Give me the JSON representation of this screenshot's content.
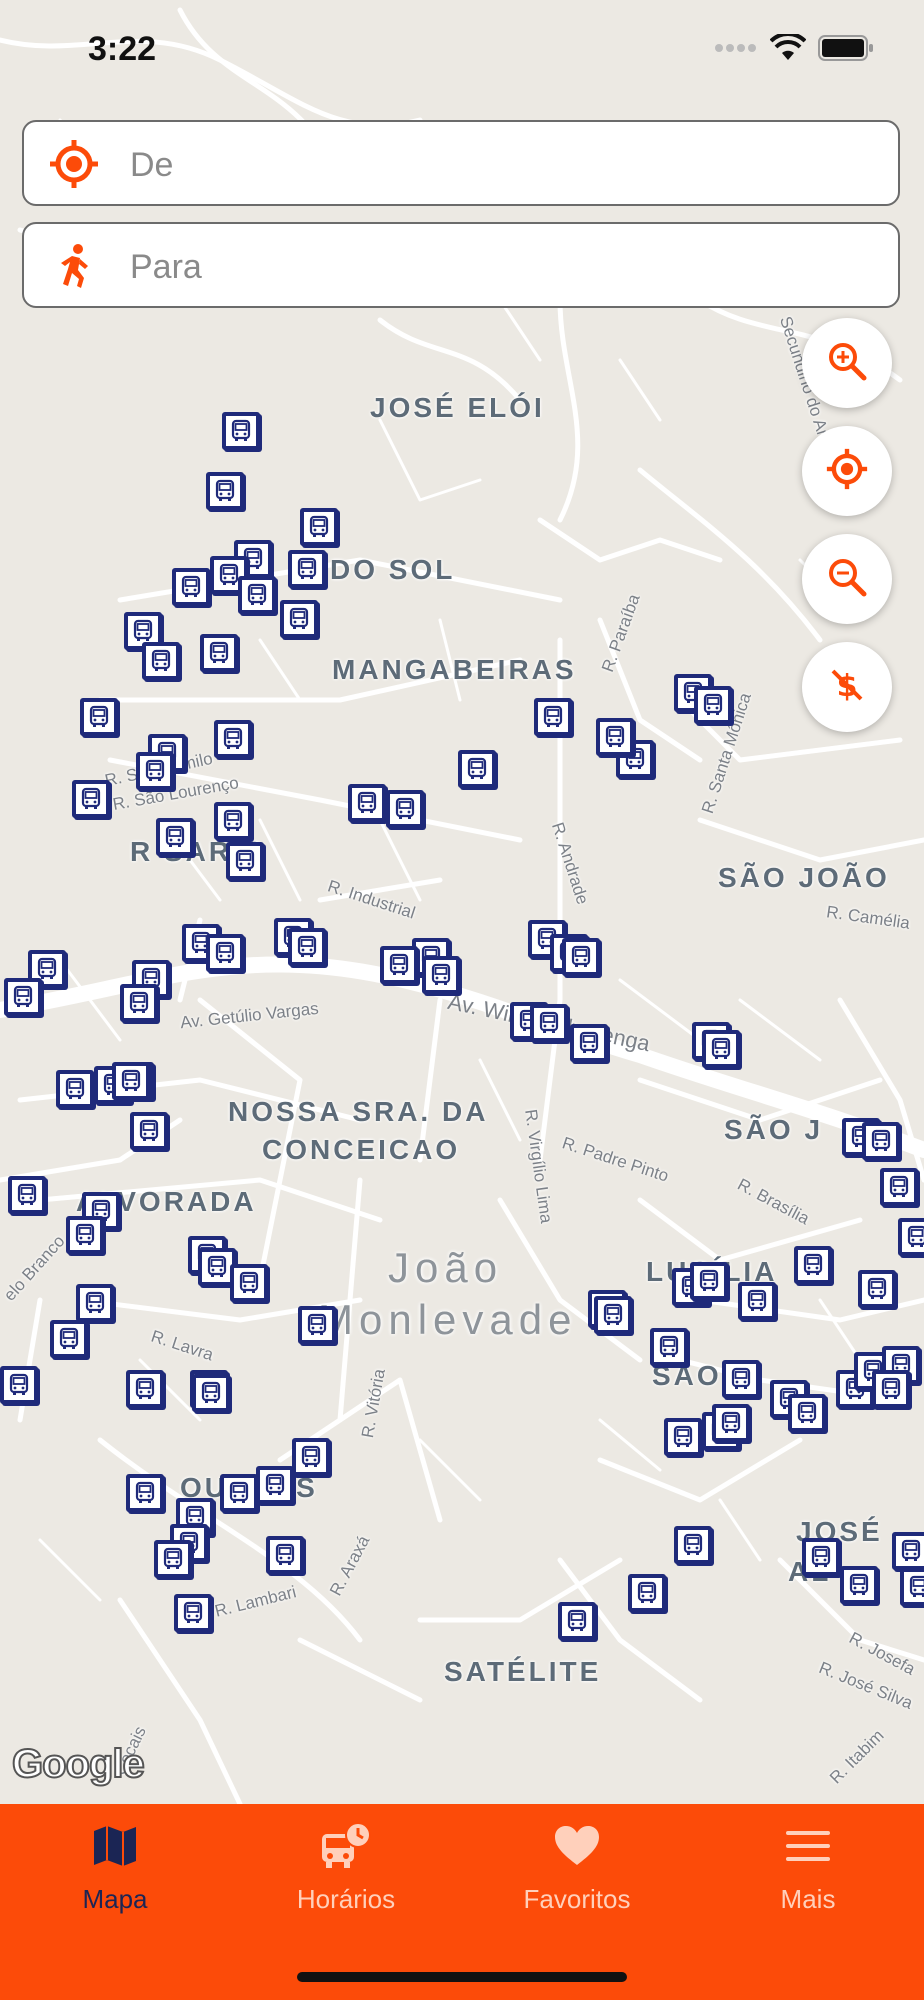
{
  "status_bar": {
    "time": "3:22"
  },
  "search": {
    "from_placeholder": "De",
    "to_placeholder": "Para"
  },
  "map": {
    "neighborhoods": [
      "JOSÉ ELÓI",
      "DO SOL",
      "MANGABEIRAS",
      "SÃO JOÃO",
      "R SARIO",
      "NOSSA SRA. DA",
      "CONCEICAO",
      "ALVORADA",
      "LUCÍLIA",
      "SÃO G",
      "SÃO J",
      "OURDES",
      "JOSÉ",
      "AL",
      "SATÉLITE"
    ],
    "city": [
      "João",
      "Monlevade"
    ],
    "streets": [
      "R. Paraíba",
      "R. Santa Mônica",
      "R. São Camilo",
      "R. São Lourenço",
      "R. Andrade",
      "R. Industrial",
      "R. Camélia",
      "Av. Getúlio Vargas",
      "Av. Wilson Alvarenga",
      "R. Virgílio Lima",
      "R. Padre Pinto",
      "R. Brasília",
      "R. Vitória",
      "R. Araxá",
      "R. Lambari",
      "R. Lavra",
      "elo Branco",
      "R. José Silva",
      "R. Itabim",
      "R. Josefa",
      "Secundino do Andr",
      "Cocais"
    ],
    "attribution": "Google"
  },
  "map_controls": {
    "zoom_in_icon": "zoom-in-icon",
    "locate_icon": "crosshair-icon",
    "zoom_out_icon": "zoom-out-icon",
    "fare_icon": "no-money-icon"
  },
  "tabs": [
    {
      "label": "Mapa",
      "icon": "map-icon",
      "active": true
    },
    {
      "label": "Horários",
      "icon": "bus-clock-icon",
      "active": false
    },
    {
      "label": "Favoritos",
      "icon": "heart-icon",
      "active": false
    },
    {
      "label": "Mais",
      "icon": "menu-icon",
      "active": false
    }
  ],
  "colors": {
    "accent": "#fc4b09",
    "stop_border": "#1f2a7a",
    "active_tab": "#1b2554",
    "inactive_tab": "#ffd0bb"
  }
}
